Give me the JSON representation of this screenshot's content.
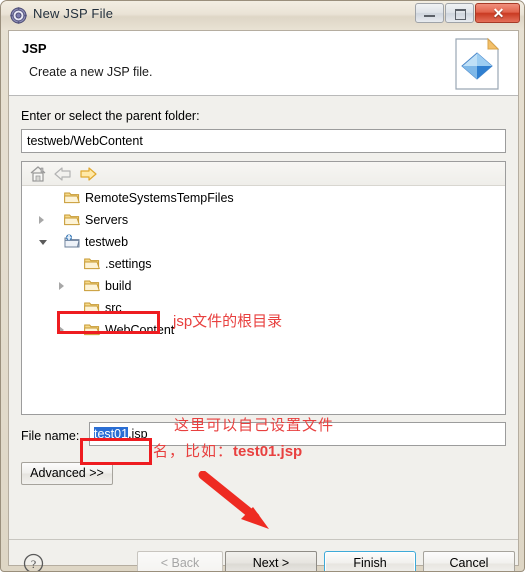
{
  "window": {
    "title": "New JSP File",
    "icon": "gear-icon",
    "controls": {
      "minimize": "minimize-icon",
      "maximize": "maximize-icon",
      "close": "✕"
    }
  },
  "header": {
    "title": "JSP",
    "subtitle": "Create a new JSP file.",
    "icon": "jsp-file-icon"
  },
  "form": {
    "parent_label": "Enter or select the parent folder:",
    "parent_value": "testweb/WebContent",
    "filename_label": "File name:",
    "filename_selected": "test01",
    "filename_rest": ".jsp",
    "advanced_label": "Advanced >>"
  },
  "tree_toolbar": {
    "home": "home-icon",
    "back": "back-arrow-icon",
    "forward": "forward-arrow-icon"
  },
  "tree": {
    "items": [
      {
        "label": "RemoteSystemsTempFiles",
        "indent": 42,
        "twisty": "none",
        "icon": "folder-icon"
      },
      {
        "label": "Servers",
        "indent": 42,
        "twisty": "collapsed",
        "icon": "folder-icon"
      },
      {
        "label": "testweb",
        "indent": 42,
        "twisty": "expanded",
        "icon": "web-project-icon"
      },
      {
        "label": ".settings",
        "indent": 62,
        "twisty": "none",
        "icon": "folder-icon"
      },
      {
        "label": "build",
        "indent": 62,
        "twisty": "collapsed",
        "icon": "folder-icon"
      },
      {
        "label": "src",
        "indent": 62,
        "twisty": "none",
        "icon": "folder-icon"
      },
      {
        "label": "WebContent",
        "indent": 62,
        "twisty": "collapsed",
        "icon": "folder-icon"
      }
    ]
  },
  "buttons": {
    "help": "?",
    "back": "< Back",
    "next": "Next >",
    "finish": "Finish",
    "cancel": "Cancel"
  },
  "annotations": {
    "root_dir_note": "jsp文件的根目录",
    "filename_note_line1": "这里可以自己设置文件",
    "filename_note_line2_prefix": "名，比如：",
    "filename_note_line2_value": "test01.jsp",
    "color": "#e8403f",
    "arrow": "red-arrow-pointing-to-next-button"
  }
}
